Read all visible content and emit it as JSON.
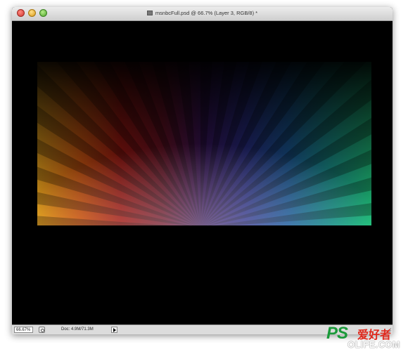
{
  "window": {
    "title": "msnbcFull.psd @ 66.7% (Layer 3, RGB/8) *"
  },
  "statusbar": {
    "zoom": "66.67%",
    "doc_info": "Doc: 4.9M/71.3M"
  },
  "artwork": {
    "colors": [
      "#e8a21c",
      "#d15a12",
      "#a41812",
      "#6e1226",
      "#3a1560",
      "#2a2f8c",
      "#1b5b9c",
      "#1a8f8a",
      "#1fbf7a"
    ]
  },
  "watermark": {
    "brand": "PS",
    "tagline": "爱好者",
    "domain": "OLIFE.COM"
  }
}
